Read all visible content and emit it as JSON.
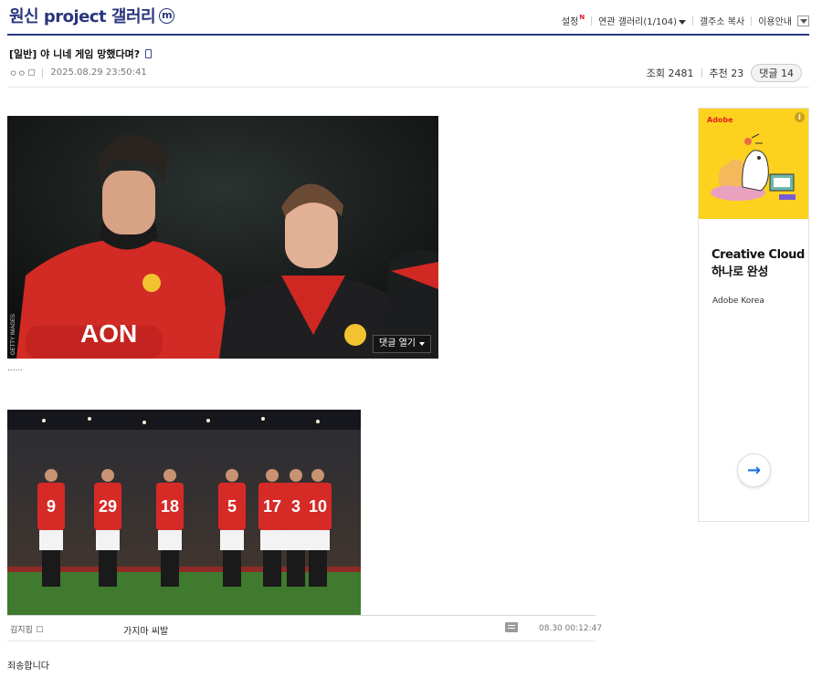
{
  "header": {
    "gallery_title": "원신 project 갤러리",
    "minor_badge": "m",
    "menu": {
      "settings": "설정",
      "settings_new": "N",
      "related": "연관 갤러리(1/104)",
      "copy_addr": "갤주소 복사",
      "guide": "이용안내"
    }
  },
  "post": {
    "title": "[일반] 야 니네 게임 망했다며?",
    "author": "ㅇㅇ",
    "datetime": "2025.08.29 23:50:41",
    "views_label": "조회 2481",
    "recommend_label": "추천 23",
    "comments_label": "댓글 14",
    "open_comments": "댓글 열기",
    "body_ellipsis": "......",
    "photo1_watermark": "GETTY IMAGES",
    "photo1_sponsor": "AON",
    "players": [
      "9",
      "29",
      "18",
      "5",
      "17",
      "3",
      "10"
    ]
  },
  "comment": {
    "author": "김지힘",
    "text": "가지마 씨발",
    "date": "08.30 00:12:47"
  },
  "bottom_text": "죄송합니다",
  "ad": {
    "brand": "Adobe",
    "info": "i",
    "headline_line1": "Creative Cloud",
    "headline_line2": "하나로 완성",
    "sponsor": "Adobe Korea",
    "arrow": "→"
  },
  "colors": {
    "brand_navy": "#29367c",
    "jersey_red": "#d62a27",
    "ad_yellow": "#fcd21e",
    "adobe_red": "#e0201b",
    "arrow_blue": "#1473e6"
  }
}
